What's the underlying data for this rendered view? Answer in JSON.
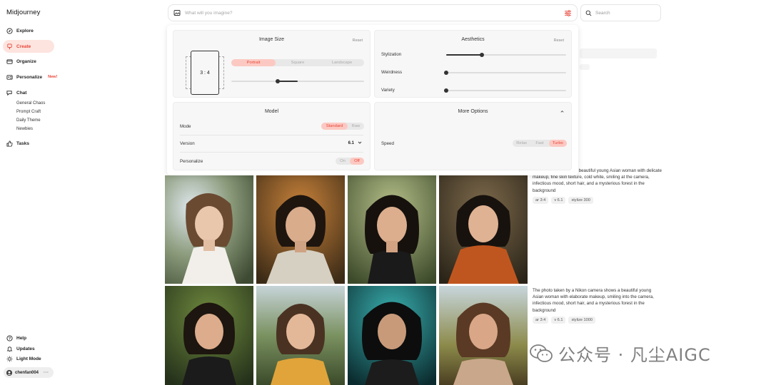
{
  "app": {
    "title": "Midjourney"
  },
  "sidebar": {
    "items": [
      {
        "label": "Explore",
        "icon": "compass-icon"
      },
      {
        "label": "Create",
        "icon": "brush-icon",
        "active": true
      },
      {
        "label": "Organize",
        "icon": "folder-icon"
      },
      {
        "label": "Personalize",
        "icon": "id-card-icon",
        "badge": "New!"
      },
      {
        "label": "Chat",
        "icon": "chat-icon"
      },
      {
        "label": "Tasks",
        "icon": "thumbs-up-icon"
      }
    ],
    "chat_rooms": [
      "General Chaos",
      "Prompt Craft",
      "Daily Theme",
      "Newbies"
    ],
    "bottom": [
      {
        "label": "Help",
        "icon": "help-icon"
      },
      {
        "label": "Updates",
        "icon": "bell-icon"
      },
      {
        "label": "Light Mode",
        "icon": "sun-icon"
      }
    ],
    "user": {
      "name": "chenfan004",
      "more": "···"
    }
  },
  "prompt": {
    "placeholder": "What will you imagine?"
  },
  "search": {
    "placeholder": "Search"
  },
  "settings": {
    "image_size": {
      "title": "Image Size",
      "reset": "Reset",
      "ratio": "3 : 4",
      "options": [
        "Portrait",
        "Square",
        "Landscape"
      ],
      "selected": "Portrait",
      "size_slider": 0.35
    },
    "aesthetics": {
      "title": "Aesthetics",
      "reset": "Reset",
      "sliders": [
        {
          "label": "Stylization",
          "value": 0.3
        },
        {
          "label": "Weirdness",
          "value": 0.0
        },
        {
          "label": "Variety",
          "value": 0.0
        }
      ]
    },
    "model": {
      "title": "Model",
      "mode_label": "Mode",
      "mode_options": [
        "Standard",
        "Raw"
      ],
      "mode_selected": "Standard",
      "version_label": "Version",
      "version_value": "6.1",
      "personalize_label": "Personalize",
      "personalize_options": [
        "On",
        "Off"
      ],
      "personalize_selected": "Off"
    },
    "more_options": {
      "title": "More Options",
      "speed_label": "Speed",
      "speed_options": [
        "Relax",
        "Fast",
        "Turbo"
      ],
      "speed_selected": "Turbo"
    }
  },
  "results": [
    {
      "prompt": "…kon camera shows a beautiful young Asian woman with delicate makeup, fine skin texture, cold white, smiling at the camera, infectious mood, short hair, and a mysterious forest in the background",
      "tags": [
        "ar 3:4",
        "v 6.1",
        "stylize 300"
      ]
    },
    {
      "prompt": "The photo taken by a Nikon camera shows a beautiful young Asian woman with elaborate makeup, smiling into the camera, infectious mood, short hair, and a mysterious forest in the background",
      "tags": [
        "ar 3:4",
        "v 6.1",
        "stylize 1000"
      ]
    }
  ],
  "watermark": {
    "text": "公众号 · 凡尘AIGC"
  },
  "colors": {
    "accent": "#e8463a",
    "accent_bg": "#fde4df"
  }
}
